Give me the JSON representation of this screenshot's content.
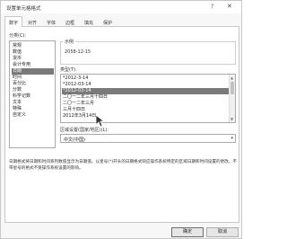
{
  "dialog": {
    "title": "设置单元格格式",
    "help": "?",
    "close": "✕"
  },
  "tabs": [
    "数字",
    "对齐",
    "字体",
    "边框",
    "填充",
    "保护"
  ],
  "category": {
    "label": "分类(C):",
    "items": [
      "常规",
      "数值",
      "货币",
      "会计专用",
      "日期",
      "时间",
      "百分比",
      "分数",
      "科学记数",
      "文本",
      "特殊",
      "自定义"
    ],
    "selected_index": 4
  },
  "sample": {
    "label": "示例",
    "value": "2058-12-15"
  },
  "type": {
    "label": "类型(T):",
    "items": [
      "*2012-3-14",
      "*2012-03-14",
      "*2012-03-14",
      "二〇一二年三月十四日",
      "二〇一二年三月",
      "三月十四日",
      "2012年3月14日"
    ],
    "selected_index": 2
  },
  "locale": {
    "label": "区域设置(国家/地区)(L):",
    "value": "中文(中国)"
  },
  "description": "日期格式将日期和时间系列数值显示为日期值。以星号(*)开头的日期格式响应操作系统特定的区域日期和时间设置的更改。不带星号的格式不受操作系统设置的影响。",
  "buttons": {
    "ok": "确定",
    "cancel": "取消"
  },
  "colors": {
    "selection": "#7a7a7a",
    "panel": "#ffffff",
    "dialog_bg": "#f7f7f7"
  }
}
